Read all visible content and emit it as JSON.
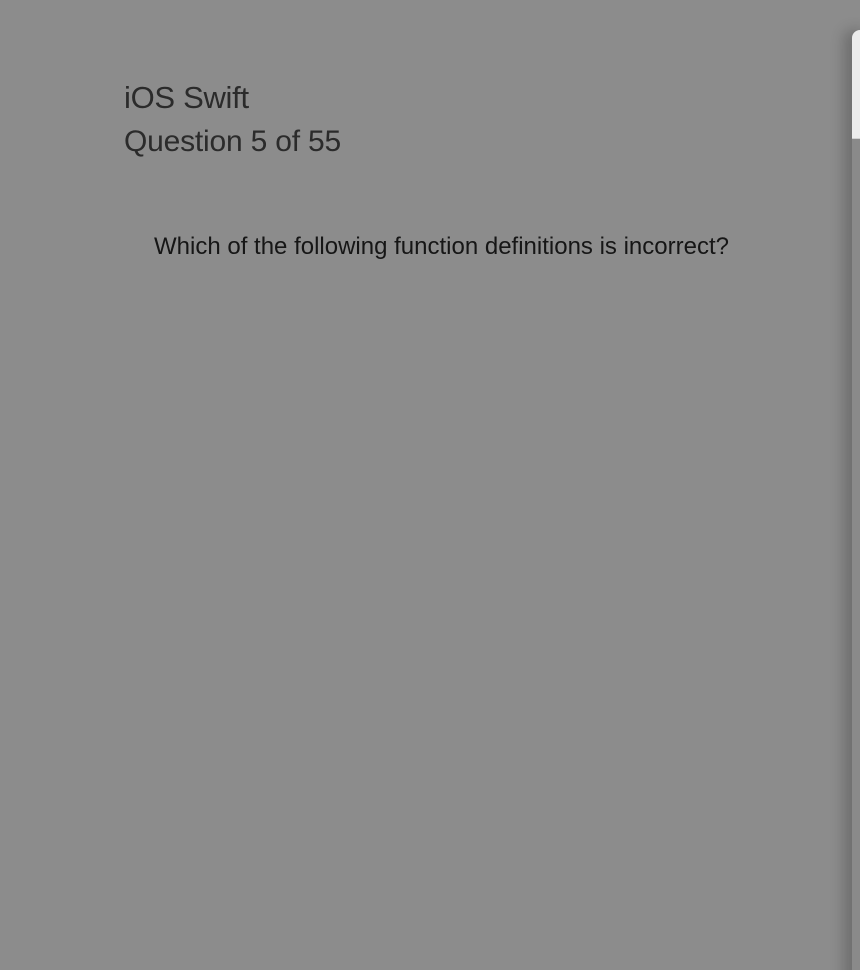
{
  "quiz": {
    "course_title": "iOS Swift",
    "question_counter": "Question 5 of 55",
    "question_text": "Which of the following function definitions is incorrect?"
  }
}
